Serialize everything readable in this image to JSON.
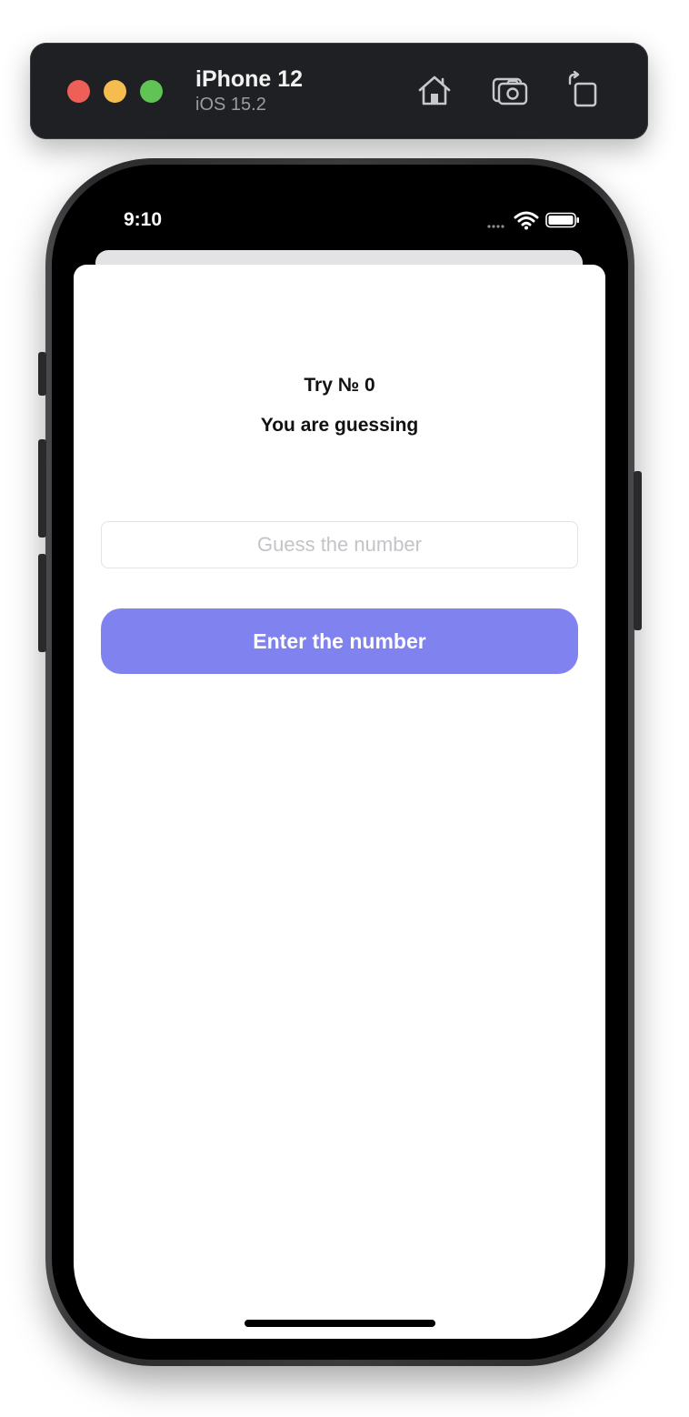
{
  "simulator": {
    "device_name": "iPhone 12",
    "os_version": "iOS 15.2",
    "window_controls": [
      "close",
      "minimize",
      "zoom"
    ],
    "toolbar_icons": [
      "home-icon",
      "screenshot-camera-icon",
      "rotate-icon"
    ],
    "colors": {
      "close": "#ee5f57",
      "minimize": "#f5bd4f",
      "zoom": "#5fc454",
      "toolbar_bg": "#1f2023"
    }
  },
  "status_bar": {
    "time": "9:10",
    "icons": [
      "signal-dots-icon",
      "wifi-icon",
      "battery-icon"
    ]
  },
  "screen": {
    "try_label": "Try № 0",
    "status_text": "You are guessing",
    "guess_input": {
      "placeholder": "Guess the number",
      "value": ""
    },
    "enter_button_label": "Enter the number",
    "accent_color": "#8083ef"
  }
}
